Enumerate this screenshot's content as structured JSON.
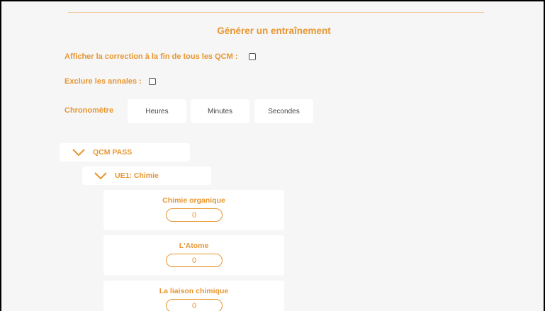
{
  "page": {
    "title": "Générer un entraînement"
  },
  "options": {
    "show_correction_label": "Afficher la correction à la fin de tous les QCM :",
    "exclude_annals_label": "Exclure les annales :",
    "chrono_label": "Chronomètre",
    "hours_placeholder": "Heures",
    "minutes_placeholder": "Minutes",
    "seconds_placeholder": "Secondes"
  },
  "tree": {
    "category": "QCM PASS",
    "subject": "UE1: Chimie",
    "chapters": [
      {
        "title": "Chimie organique",
        "count": "0"
      },
      {
        "title": "L'Atome",
        "count": "0"
      },
      {
        "title": "La liaison chimique",
        "count": "0"
      }
    ]
  },
  "colors": {
    "accent": "#e8962f",
    "background": "#f6f6f7"
  }
}
